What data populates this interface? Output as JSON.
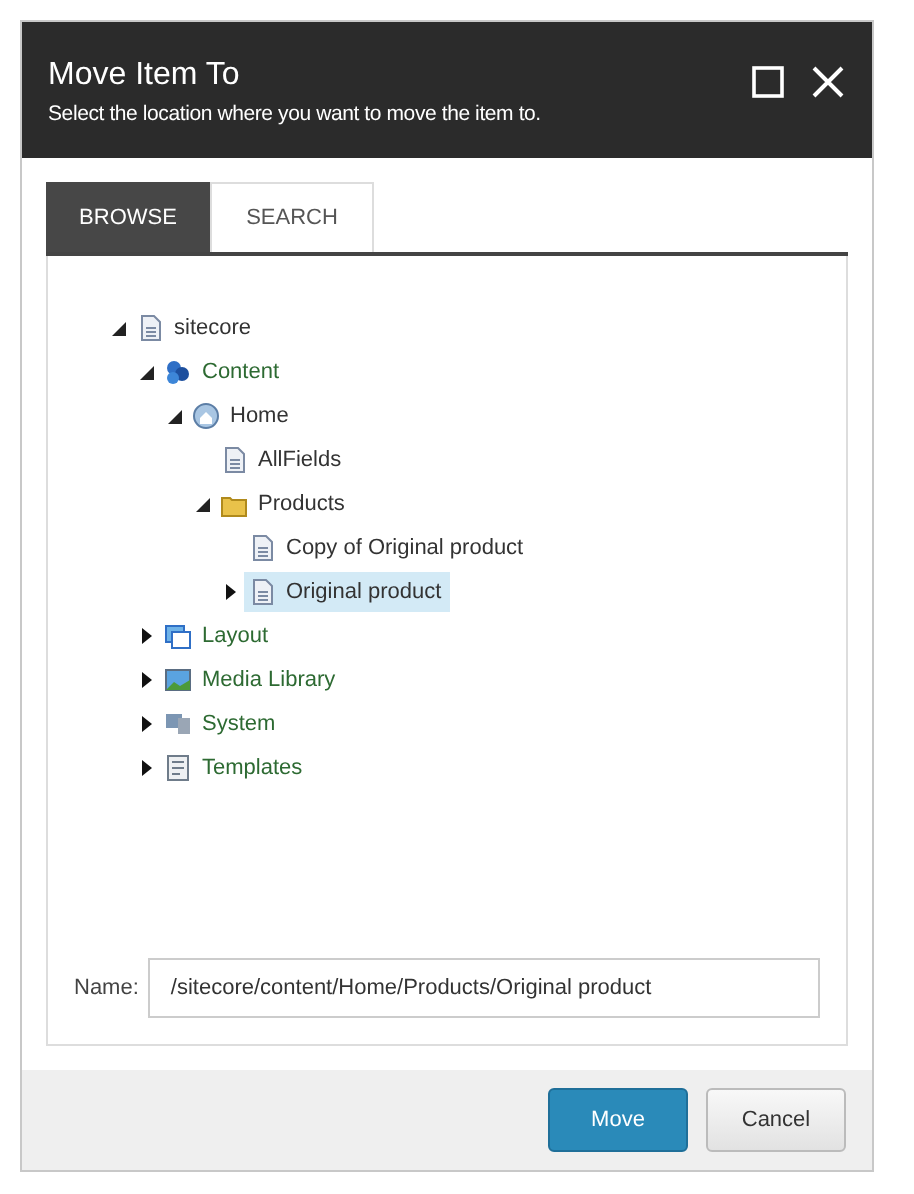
{
  "dialog": {
    "title": "Move Item To",
    "subtitle": "Select the location where you want to move the item to."
  },
  "tabs": [
    {
      "label": "BROWSE",
      "selected": true
    },
    {
      "label": "SEARCH",
      "selected": false
    }
  ],
  "tree": [
    {
      "label": "sitecore",
      "kind": "page",
      "expanded": true,
      "selected": false,
      "children": [
        {
          "label": "Content",
          "kind": "content",
          "expanded": true,
          "selected": false,
          "children": [
            {
              "label": "Home",
              "kind": "home",
              "expanded": true,
              "selected": false,
              "children": [
                {
                  "label": "AllFields",
                  "kind": "page",
                  "selected": false
                },
                {
                  "label": "Products",
                  "kind": "folder",
                  "expanded": true,
                  "selected": false,
                  "children": [
                    {
                      "label": "Copy of Original product",
                      "kind": "page",
                      "selected": false
                    },
                    {
                      "label": "Original product",
                      "kind": "page",
                      "expanded": false,
                      "selected": true
                    }
                  ]
                }
              ]
            }
          ]
        },
        {
          "label": "Layout",
          "kind": "layout",
          "expanded": false,
          "selected": false
        },
        {
          "label": "Media Library",
          "kind": "media",
          "expanded": false,
          "selected": false
        },
        {
          "label": "System",
          "kind": "system",
          "expanded": false,
          "selected": false
        },
        {
          "label": "Templates",
          "kind": "templates",
          "expanded": false,
          "selected": false
        }
      ]
    }
  ],
  "name_field": {
    "label": "Name:",
    "value": "/sitecore/content/Home/Products/Original product"
  },
  "buttons": [
    {
      "label": "Move",
      "kind": "primary"
    },
    {
      "label": "Cancel",
      "kind": "secondary"
    }
  ]
}
